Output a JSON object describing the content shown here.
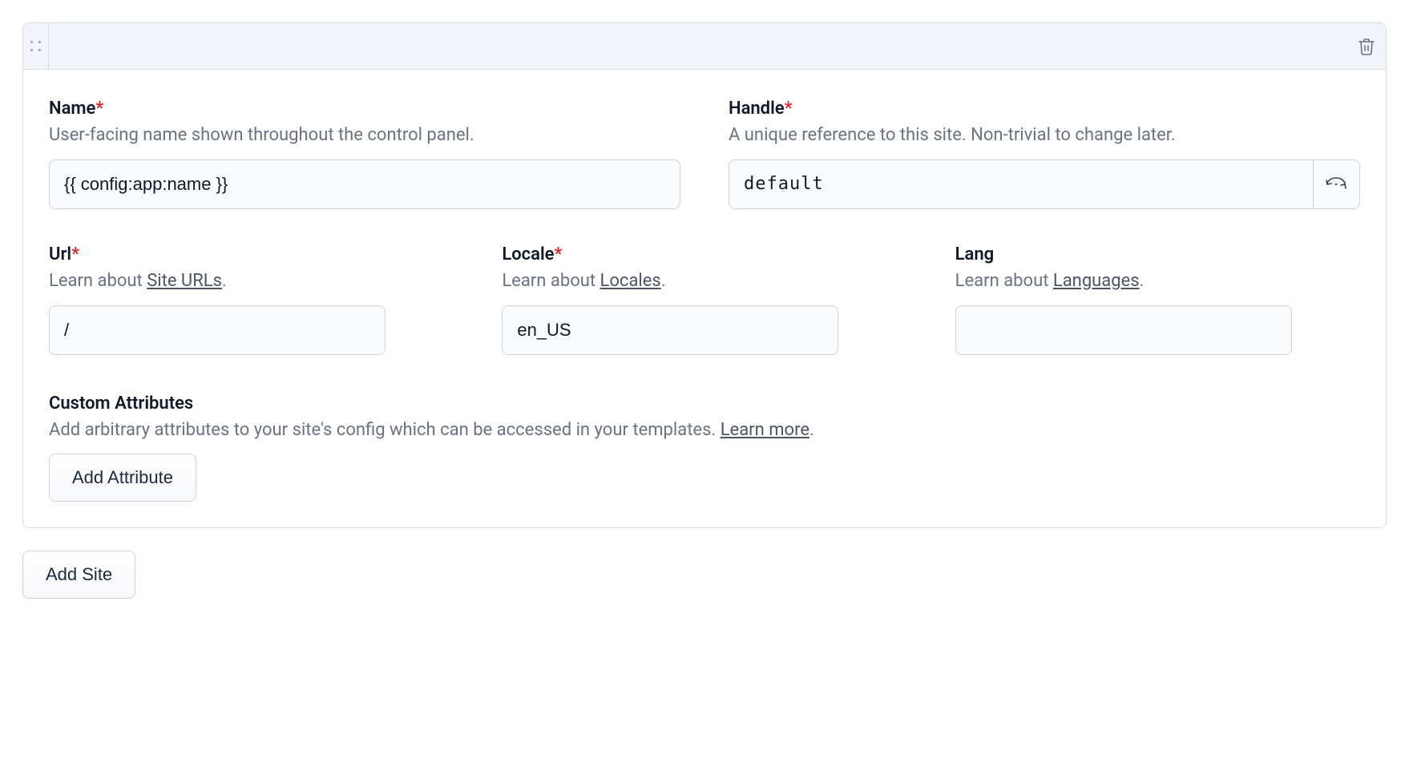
{
  "fields": {
    "name": {
      "label": "Name",
      "required": true,
      "help": "User-facing name shown throughout the control panel.",
      "value": "{{ config:app:name }}"
    },
    "handle": {
      "label": "Handle",
      "required": true,
      "help": "A unique reference to this site. Non-trivial to change later.",
      "value": "default"
    },
    "url": {
      "label": "Url",
      "required": true,
      "help_prefix": "Learn about ",
      "help_link": "Site URLs",
      "help_suffix": ".",
      "value": "/"
    },
    "locale": {
      "label": "Locale",
      "required": true,
      "help_prefix": "Learn about ",
      "help_link": "Locales",
      "help_suffix": ".",
      "value": "en_US"
    },
    "lang": {
      "label": "Lang",
      "required": false,
      "help_prefix": "Learn about ",
      "help_link": "Languages",
      "help_suffix": ".",
      "value": ""
    }
  },
  "custom_attributes": {
    "title": "Custom Attributes",
    "help_text": "Add arbitrary attributes to your site's config which can be accessed in your templates. ",
    "help_link": "Learn more",
    "help_suffix": ".",
    "button": "Add Attribute"
  },
  "add_site_button": "Add Site",
  "required_marker": "*"
}
